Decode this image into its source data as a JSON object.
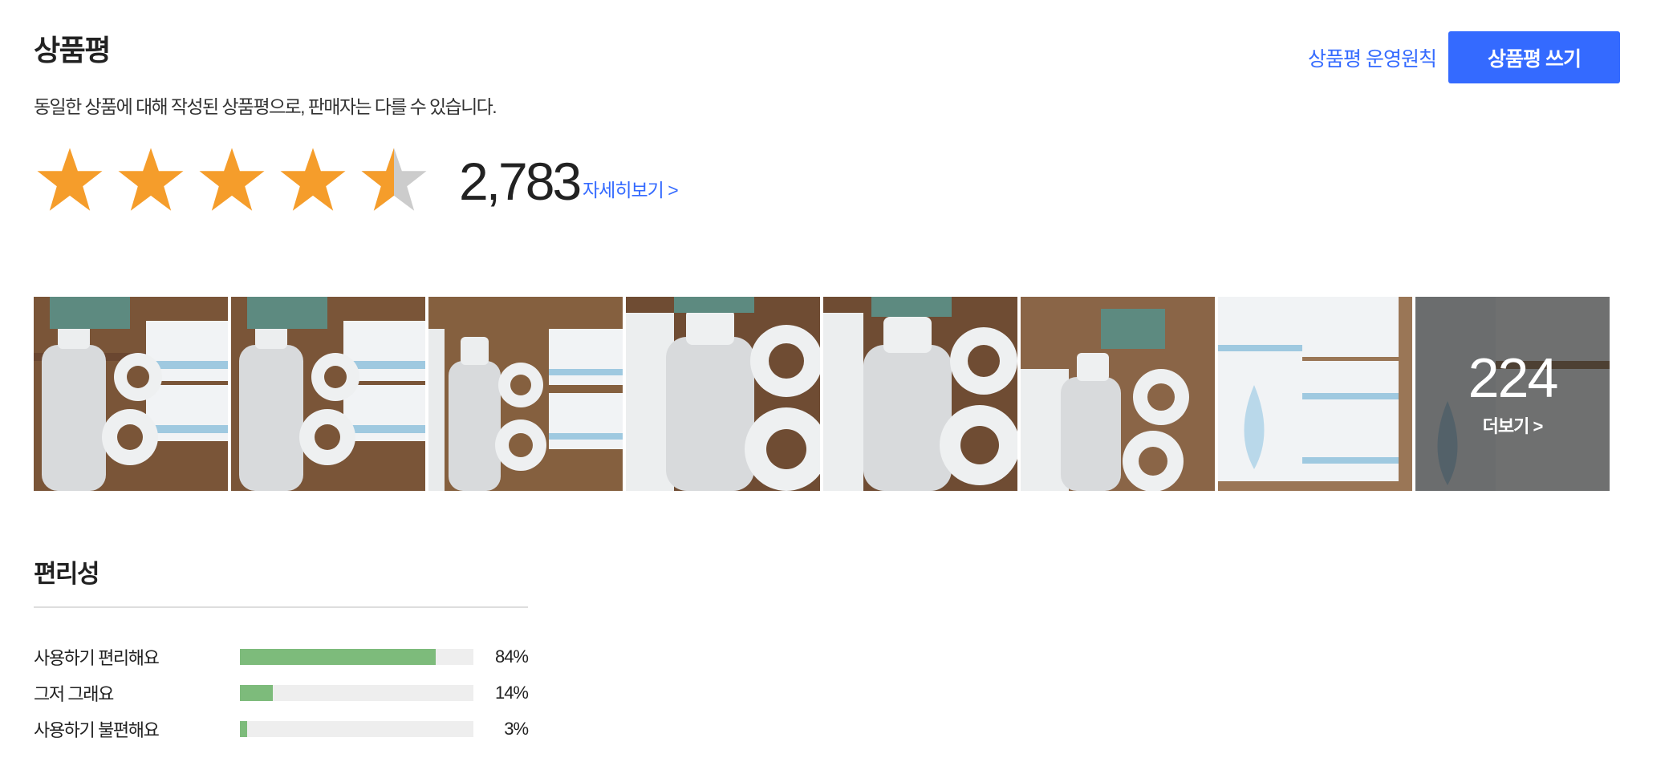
{
  "header": {
    "title": "상품평",
    "description": "동일한 상품에 대해 작성된 상품평으로, 판매자는 다를 수 있습니다.",
    "policy_link": "상품평 운영원칙",
    "write_button": "상품평 쓰기"
  },
  "rating": {
    "stars": 4.5,
    "max_stars": 5,
    "review_count": "2,783",
    "detail_link": "자세히보기 >",
    "star_color": "#f59d2b",
    "star_empty_color": "#cccccc"
  },
  "photos": {
    "thumbnails": [
      {
        "alt": "product-photo"
      },
      {
        "alt": "product-photo"
      },
      {
        "alt": "product-photo"
      },
      {
        "alt": "product-photo"
      },
      {
        "alt": "product-photo"
      },
      {
        "alt": "product-photo"
      },
      {
        "alt": "product-photo"
      },
      {
        "alt": "product-photo"
      }
    ],
    "more_count": "224",
    "more_label": "더보기 >"
  },
  "survey": {
    "title": "편리성",
    "rows": [
      {
        "label": "사용하기 편리해요",
        "percent": "84%",
        "value": 84
      },
      {
        "label": "그저 그래요",
        "percent": "14%",
        "value": 14
      },
      {
        "label": "사용하기 불편해요",
        "percent": "3%",
        "value": 3
      }
    ],
    "bar_color": "#7dbb7b"
  },
  "colors": {
    "accent": "#346aff"
  }
}
